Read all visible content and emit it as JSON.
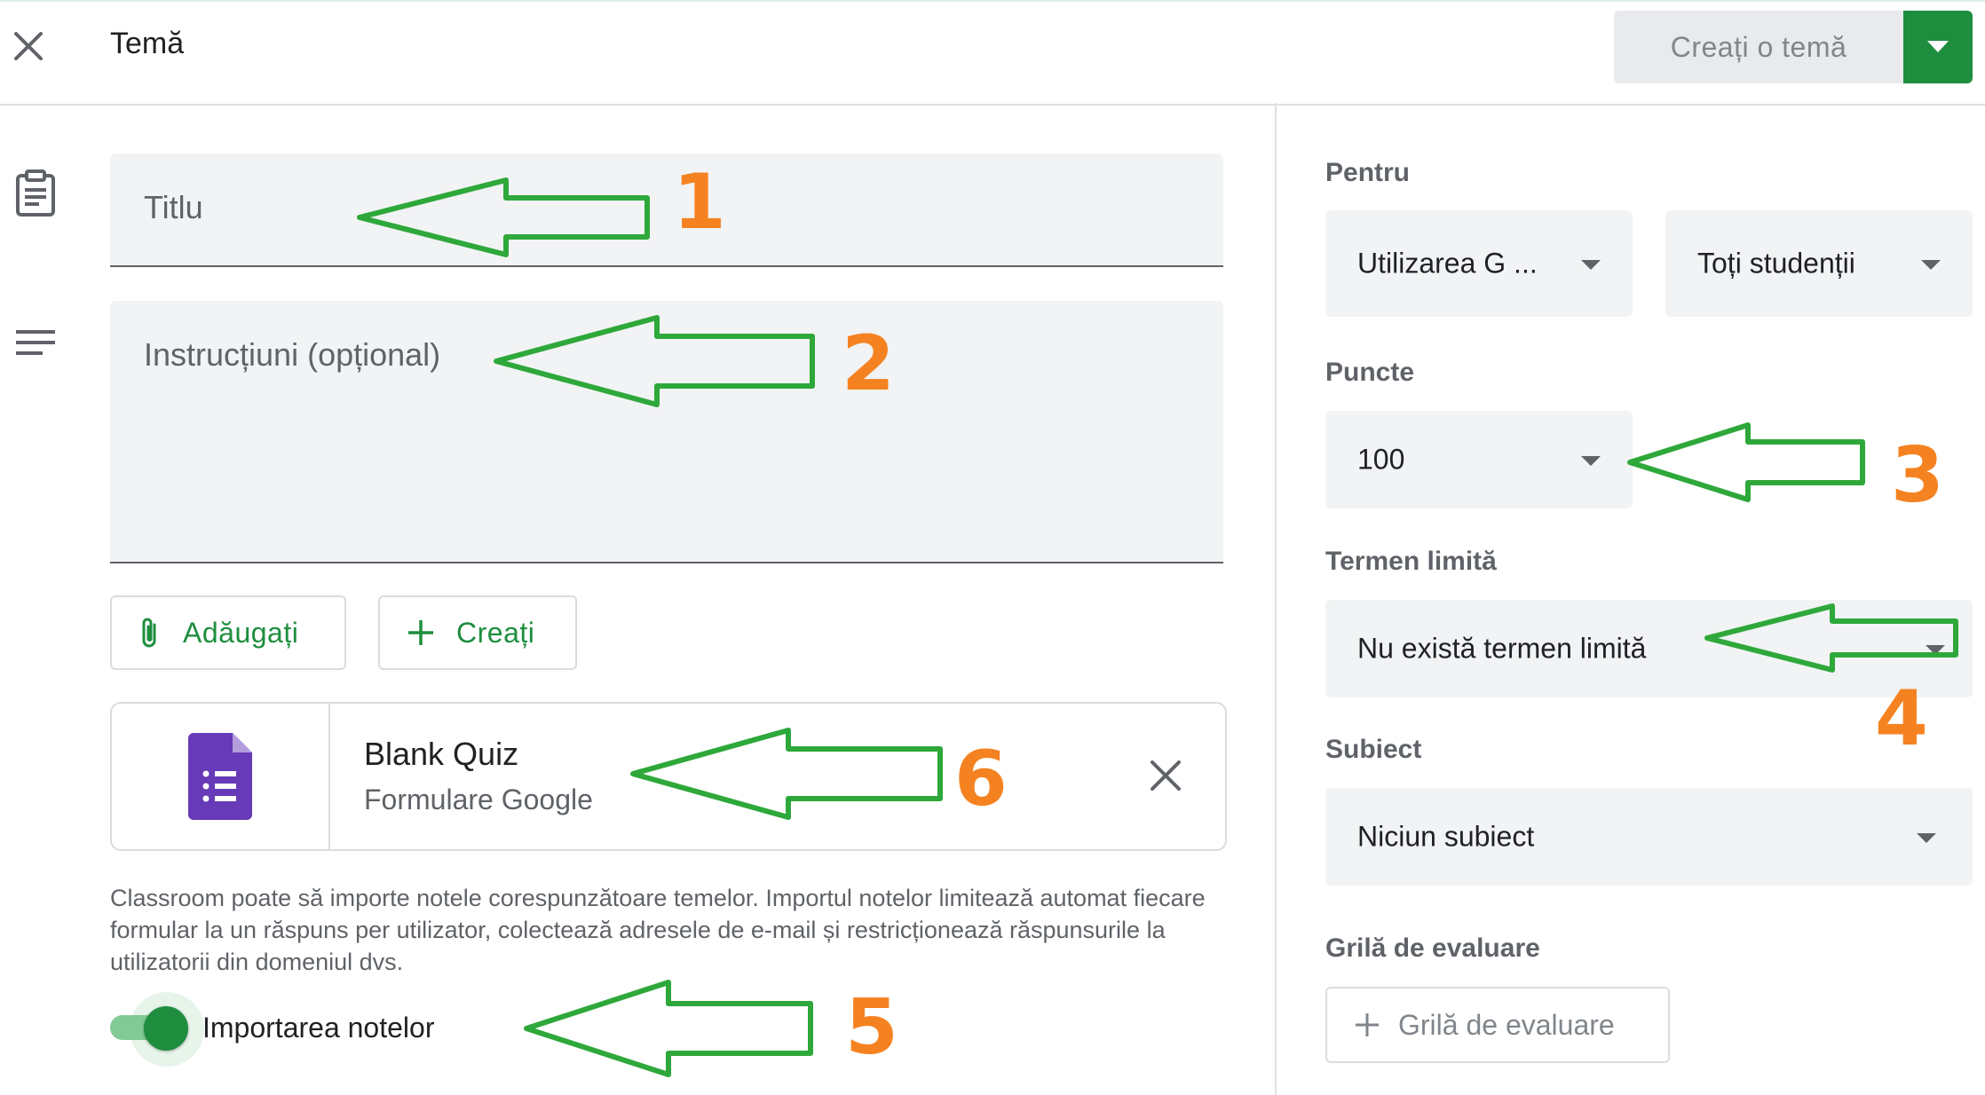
{
  "header": {
    "title": "Temă",
    "create_label": "Creați o temă"
  },
  "main": {
    "title_placeholder": "Titlu",
    "instructions_placeholder": "Instrucțiuni (opțional)",
    "add_label": "Adăugați",
    "create_label": "Creați",
    "attachment": {
      "title": "Blank Quiz",
      "subtitle": "Formulare Google"
    },
    "info_text": "Classroom poate să importe notele corespunzătoare temelor. Importul notelor limitează automat fiecare formular la un răspuns per utilizator, colectează adresele de e-mail și restricționează răspunsurile la utilizatorii din domeniul dvs.",
    "import_grades_label": "Importarea notelor",
    "import_grades_on": true
  },
  "sidebar": {
    "for_label": "Pentru",
    "class_value": "Utilizarea G ...",
    "students_value": "Toți studenții",
    "points_label": "Puncte",
    "points_value": "100",
    "due_label": "Termen limită",
    "due_value": "Nu există termen limită",
    "topic_label": "Subiect",
    "topic_value": "Niciun subiect",
    "rubric_label": "Grilă de evaluare",
    "rubric_button": "Grilă de evaluare"
  },
  "annotations": [
    "1",
    "2",
    "3",
    "4",
    "5",
    "6"
  ],
  "colors": {
    "accent_green": "#1e8e3e",
    "annotation_arrow": "#2ea83a",
    "annotation_number": "#f58220",
    "forms_purple": "#673ab7"
  }
}
